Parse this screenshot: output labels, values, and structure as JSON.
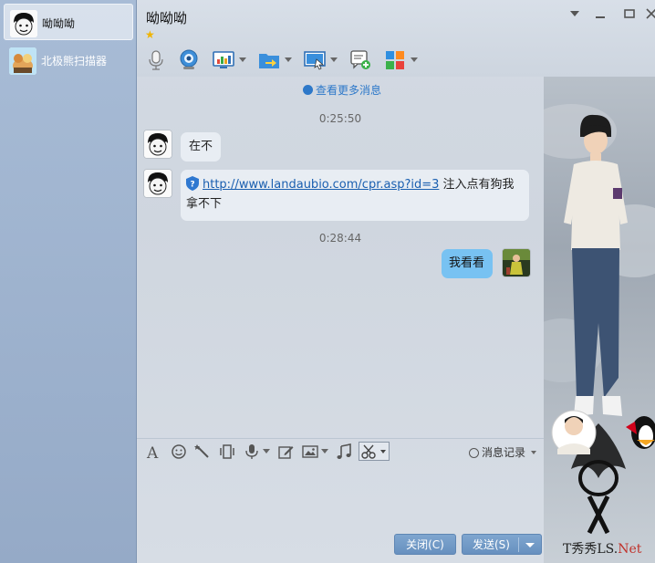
{
  "window": {
    "title": "呦呦呦"
  },
  "sidebar": {
    "contacts": [
      {
        "name": "呦呦呦",
        "active": true
      },
      {
        "name": "北极熊扫描器",
        "active": false
      }
    ]
  },
  "toolbar": {
    "icons": [
      "microphone-icon",
      "webcam-icon",
      "screen-share-icon",
      "file-transfer-icon",
      "remote-desktop-icon",
      "new-note-icon",
      "apps-icon"
    ]
  },
  "messages": {
    "more_link": "查看更多消息",
    "items": [
      {
        "type": "time",
        "text": "0:25:50"
      },
      {
        "type": "incoming",
        "text": "在不"
      },
      {
        "type": "incoming_link",
        "url": "http://www.landaubio.com/cpr.asp?id=3",
        "text_after": " 注入点有狗我拿不下"
      },
      {
        "type": "time",
        "text": "0:28:44"
      },
      {
        "type": "outgoing",
        "text": "我看看"
      }
    ]
  },
  "input_toolbar": {
    "history_label": "消息记录"
  },
  "buttons": {
    "close_label": "关闭(C)",
    "send_label": "发送(S)"
  },
  "watermark": {
    "text_a": "T秀秀LS.",
    "text_b": "Net"
  },
  "colors": {
    "accent": "#2d78c9",
    "outgoing_bubble": "#78c2f2",
    "sidebar": "#9eb2cd"
  }
}
